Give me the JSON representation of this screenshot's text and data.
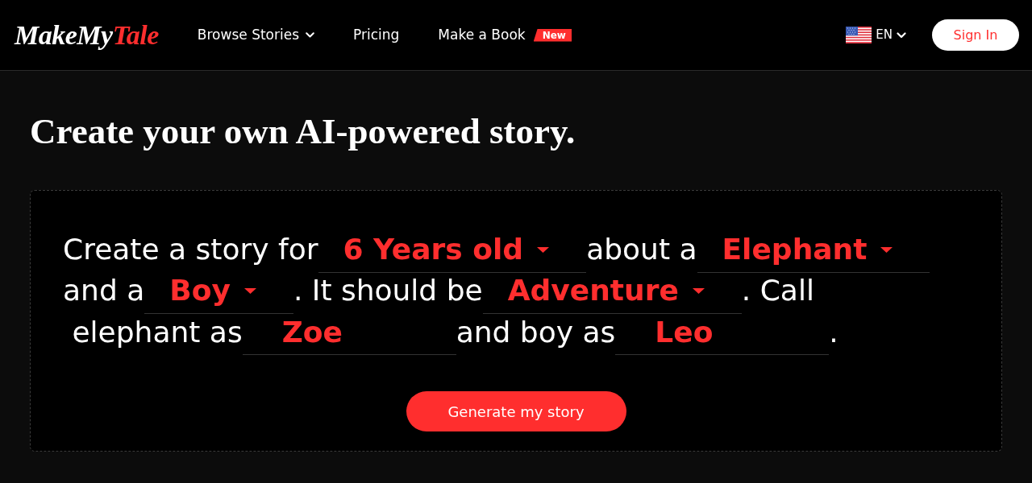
{
  "header": {
    "logo": {
      "text": "MakeMy",
      "accent": "Tale"
    },
    "nav": [
      {
        "kind": "dropdown",
        "label": "Browse Stories"
      },
      {
        "kind": "link",
        "label": "Pricing"
      },
      {
        "kind": "link",
        "label": "Make a Book",
        "badge": "New"
      }
    ],
    "language": {
      "label": "EN"
    },
    "sign_in": "Sign In"
  },
  "heading": "Create your own AI-powered story.",
  "story_form": {
    "lines": [
      [
        {
          "kind": "text",
          "text": "Create a story for"
        },
        {
          "kind": "select",
          "value": "6 Years old"
        },
        {
          "kind": "text",
          "text": "about a"
        },
        {
          "kind": "select",
          "value": "Elephant"
        }
      ],
      [
        {
          "kind": "text",
          "text": "and a"
        },
        {
          "kind": "select",
          "value": "Boy"
        },
        {
          "kind": "text",
          "text": ". It should be"
        },
        {
          "kind": "select",
          "value": "Adventure"
        },
        {
          "kind": "text",
          "text": ". Call"
        }
      ],
      [
        {
          "kind": "text",
          "text": " elephant as"
        },
        {
          "kind": "input",
          "value": "Zoe"
        },
        {
          "kind": "text",
          "text": "and boy as"
        },
        {
          "kind": "input",
          "value": "Leo"
        },
        {
          "kind": "text",
          "text": "."
        }
      ]
    ],
    "button": "Generate my story"
  }
}
